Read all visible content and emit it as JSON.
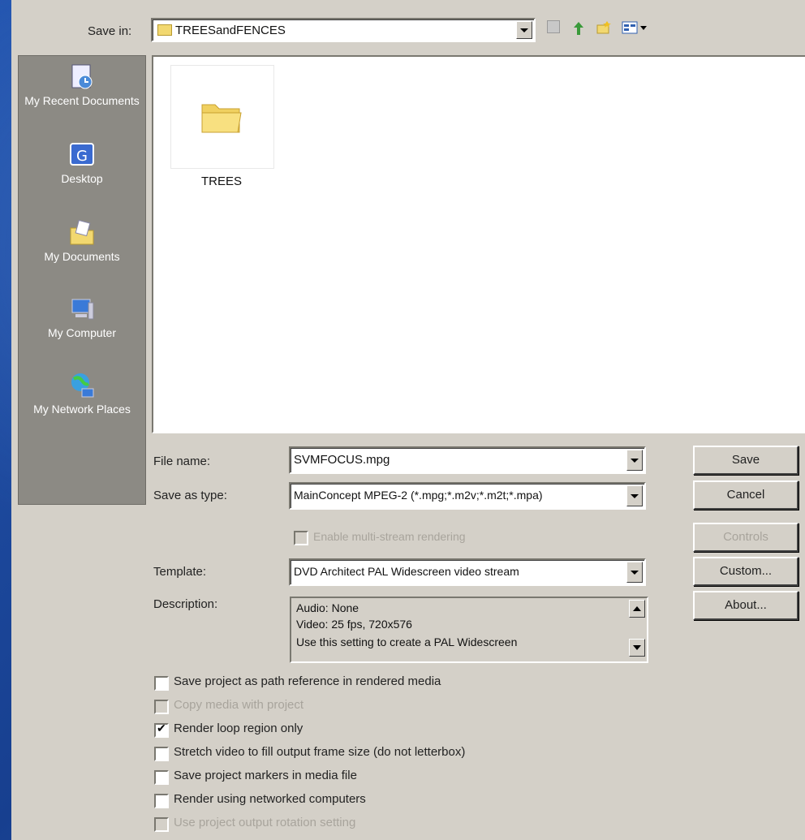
{
  "save_in": {
    "label": "Save in:",
    "value": "TREESandFENCES"
  },
  "places": [
    {
      "label": "My Recent Documents",
      "icon": "recent-documents-icon"
    },
    {
      "label": "Desktop",
      "icon": "desktop-icon"
    },
    {
      "label": "My Documents",
      "icon": "my-documents-icon"
    },
    {
      "label": "My Computer",
      "icon": "my-computer-icon"
    },
    {
      "label": "My Network Places",
      "icon": "network-places-icon"
    }
  ],
  "files": [
    {
      "name": "TREES",
      "icon": "folder-icon"
    }
  ],
  "form": {
    "file_name_label": "File name:",
    "file_name_value": "SVMFOCUS.mpg",
    "save_as_type_label": "Save as type:",
    "save_as_type_value": "MainConcept MPEG-2 (*.mpg;*.m2v;*.m2t;*.mpa)",
    "enable_label": "Enable multi-stream rendering",
    "template_label": "Template:",
    "template_value": "DVD Architect PAL Widescreen video stream",
    "description_label": "Description:",
    "description_lines": [
      "Audio: None",
      "Video: 25 fps, 720x576",
      "Use this setting to create a PAL Widescreen"
    ]
  },
  "buttons": {
    "save": "Save",
    "cancel": "Cancel",
    "controls": "Controls",
    "custom": "Custom...",
    "about": "About..."
  },
  "options": [
    {
      "label": "Save project as path reference in rendered media",
      "checked": false,
      "enabled": true
    },
    {
      "label": "Copy media with project",
      "checked": false,
      "enabled": false
    },
    {
      "label": "Render loop region only",
      "checked": true,
      "enabled": true
    },
    {
      "label": "Stretch video to fill output frame size (do not letterbox)",
      "checked": false,
      "enabled": true
    },
    {
      "label": "Save project markers in media file",
      "checked": false,
      "enabled": true
    },
    {
      "label": "Render using networked computers",
      "checked": false,
      "enabled": true
    },
    {
      "label": "Use project output rotation setting",
      "checked": false,
      "enabled": false
    }
  ]
}
